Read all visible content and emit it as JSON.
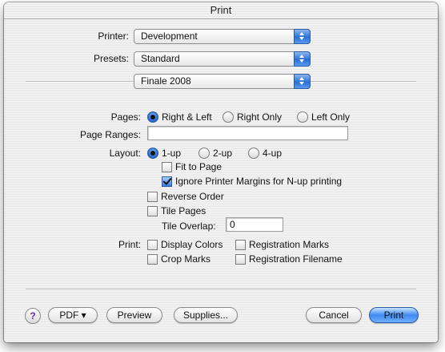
{
  "window": {
    "title": "Print"
  },
  "printer": {
    "label": "Printer:",
    "value": "Development"
  },
  "presets": {
    "label": "Presets:",
    "value": "Standard"
  },
  "panel": {
    "value": "Finale 2008"
  },
  "pages": {
    "label": "Pages:",
    "options": [
      "Right & Left",
      "Right Only",
      "Left Only"
    ],
    "selected": "Right & Left"
  },
  "page_ranges": {
    "label": "Page Ranges:",
    "value": ""
  },
  "layout": {
    "label": "Layout:",
    "options": [
      "1-up",
      "2-up",
      "4-up"
    ],
    "selected": "1-up",
    "fit_to_page": "Fit to Page",
    "ignore_margins": "Ignore Printer Margins for N-up printing",
    "reverse_order": "Reverse Order",
    "tile_pages": "Tile Pages",
    "tile_overlap_label": "Tile Overlap:",
    "tile_overlap_value": "0"
  },
  "print_opts": {
    "label": "Print:",
    "display_colors": "Display Colors",
    "registration_marks": "Registration Marks",
    "crop_marks": "Crop Marks",
    "registration_filename": "Registration Filename"
  },
  "buttons": {
    "help": "?",
    "pdf": "PDF ▾",
    "preview": "Preview",
    "supplies": "Supplies...",
    "cancel": "Cancel",
    "print": "Print"
  },
  "colors": {
    "accent": "#2a6fd6"
  }
}
